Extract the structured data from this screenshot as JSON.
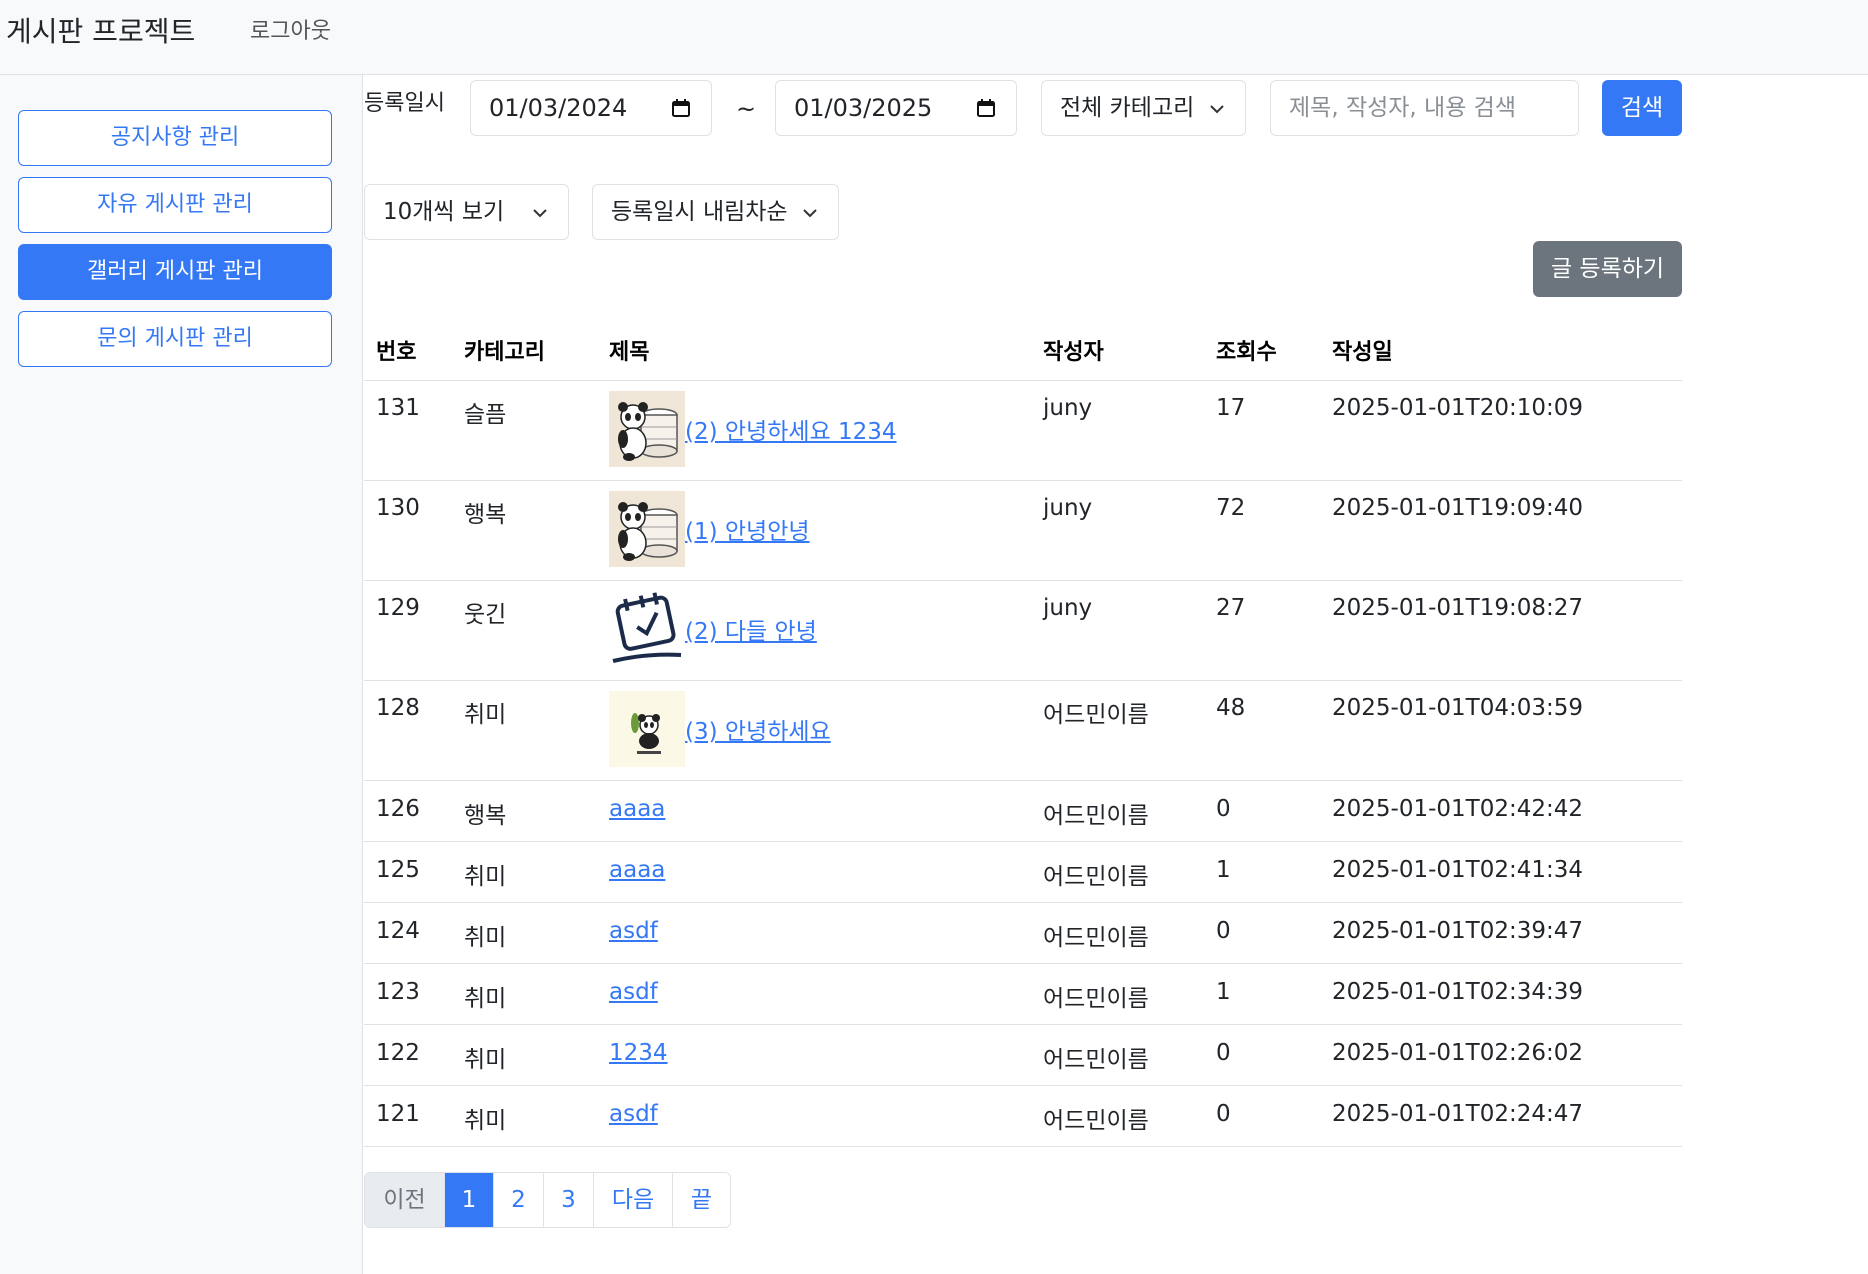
{
  "header": {
    "brand": "게시판 프로젝트",
    "logout": "로그아웃"
  },
  "sidebar": {
    "items": [
      {
        "label": "공지사항 관리",
        "active": false
      },
      {
        "label": "자유 게시판 관리",
        "active": false
      },
      {
        "label": "갤러리 게시판 관리",
        "active": true
      },
      {
        "label": "문의 게시판 관리",
        "active": false
      }
    ]
  },
  "filters": {
    "date_label": "등록일시",
    "start_date": "01/03/2024",
    "separator": "~",
    "end_date": "01/03/2025",
    "category": "전체 카테고리",
    "search_placeholder": "제목, 작성자, 내용 검색",
    "search_button": "검색",
    "page_size": "10개씩 보기",
    "sort": "등록일시 내림차순",
    "write_button": "글 등록하기"
  },
  "table": {
    "columns": [
      "번호",
      "카테고리",
      "제목",
      "작성자",
      "조회수",
      "작성일"
    ],
    "rows": [
      {
        "no": "131",
        "category": "슬픔",
        "thumb": "panda-database",
        "title": "(2) 안녕하세요 1234",
        "author": "juny",
        "views": "17",
        "date": "2025-01-01T20:10:09"
      },
      {
        "no": "130",
        "category": "행복",
        "thumb": "panda-database",
        "title": "(1) 안녕안녕",
        "author": "juny",
        "views": "72",
        "date": "2025-01-01T19:09:40"
      },
      {
        "no": "129",
        "category": "웃긴",
        "thumb": "calendar-space-reserve",
        "title": "(2) 다들 안녕",
        "author": "juny",
        "views": "27",
        "date": "2025-01-01T19:08:27"
      },
      {
        "no": "128",
        "category": "취미",
        "thumb": "panda-spring",
        "title": "(3) 안녕하세요",
        "author": "어드민이름",
        "views": "48",
        "date": "2025-01-01T04:03:59"
      },
      {
        "no": "126",
        "category": "행복",
        "thumb": null,
        "title": "aaaa",
        "author": "어드민이름",
        "views": "0",
        "date": "2025-01-01T02:42:42"
      },
      {
        "no": "125",
        "category": "취미",
        "thumb": null,
        "title": "aaaa",
        "author": "어드민이름",
        "views": "1",
        "date": "2025-01-01T02:41:34"
      },
      {
        "no": "124",
        "category": "취미",
        "thumb": null,
        "title": "asdf",
        "author": "어드민이름",
        "views": "0",
        "date": "2025-01-01T02:39:47"
      },
      {
        "no": "123",
        "category": "취미",
        "thumb": null,
        "title": "asdf",
        "author": "어드민이름",
        "views": "1",
        "date": "2025-01-01T02:34:39"
      },
      {
        "no": "122",
        "category": "취미",
        "thumb": null,
        "title": "1234",
        "author": "어드민이름",
        "views": "0",
        "date": "2025-01-01T02:26:02"
      },
      {
        "no": "121",
        "category": "취미",
        "thumb": null,
        "title": "asdf",
        "author": "어드민이름",
        "views": "0",
        "date": "2025-01-01T02:24:47"
      }
    ]
  },
  "pagination": {
    "items": [
      {
        "label": "이전",
        "state": "disabled"
      },
      {
        "label": "1",
        "state": "active"
      },
      {
        "label": "2",
        "state": "normal"
      },
      {
        "label": "3",
        "state": "normal"
      },
      {
        "label": "다음",
        "state": "normal"
      },
      {
        "label": "끝",
        "state": "normal"
      }
    ]
  },
  "colors": {
    "primary": "#3478f6",
    "secondary": "#6c757d",
    "border": "#dee2e6",
    "sidebar_bg": "#f8f9fa"
  }
}
